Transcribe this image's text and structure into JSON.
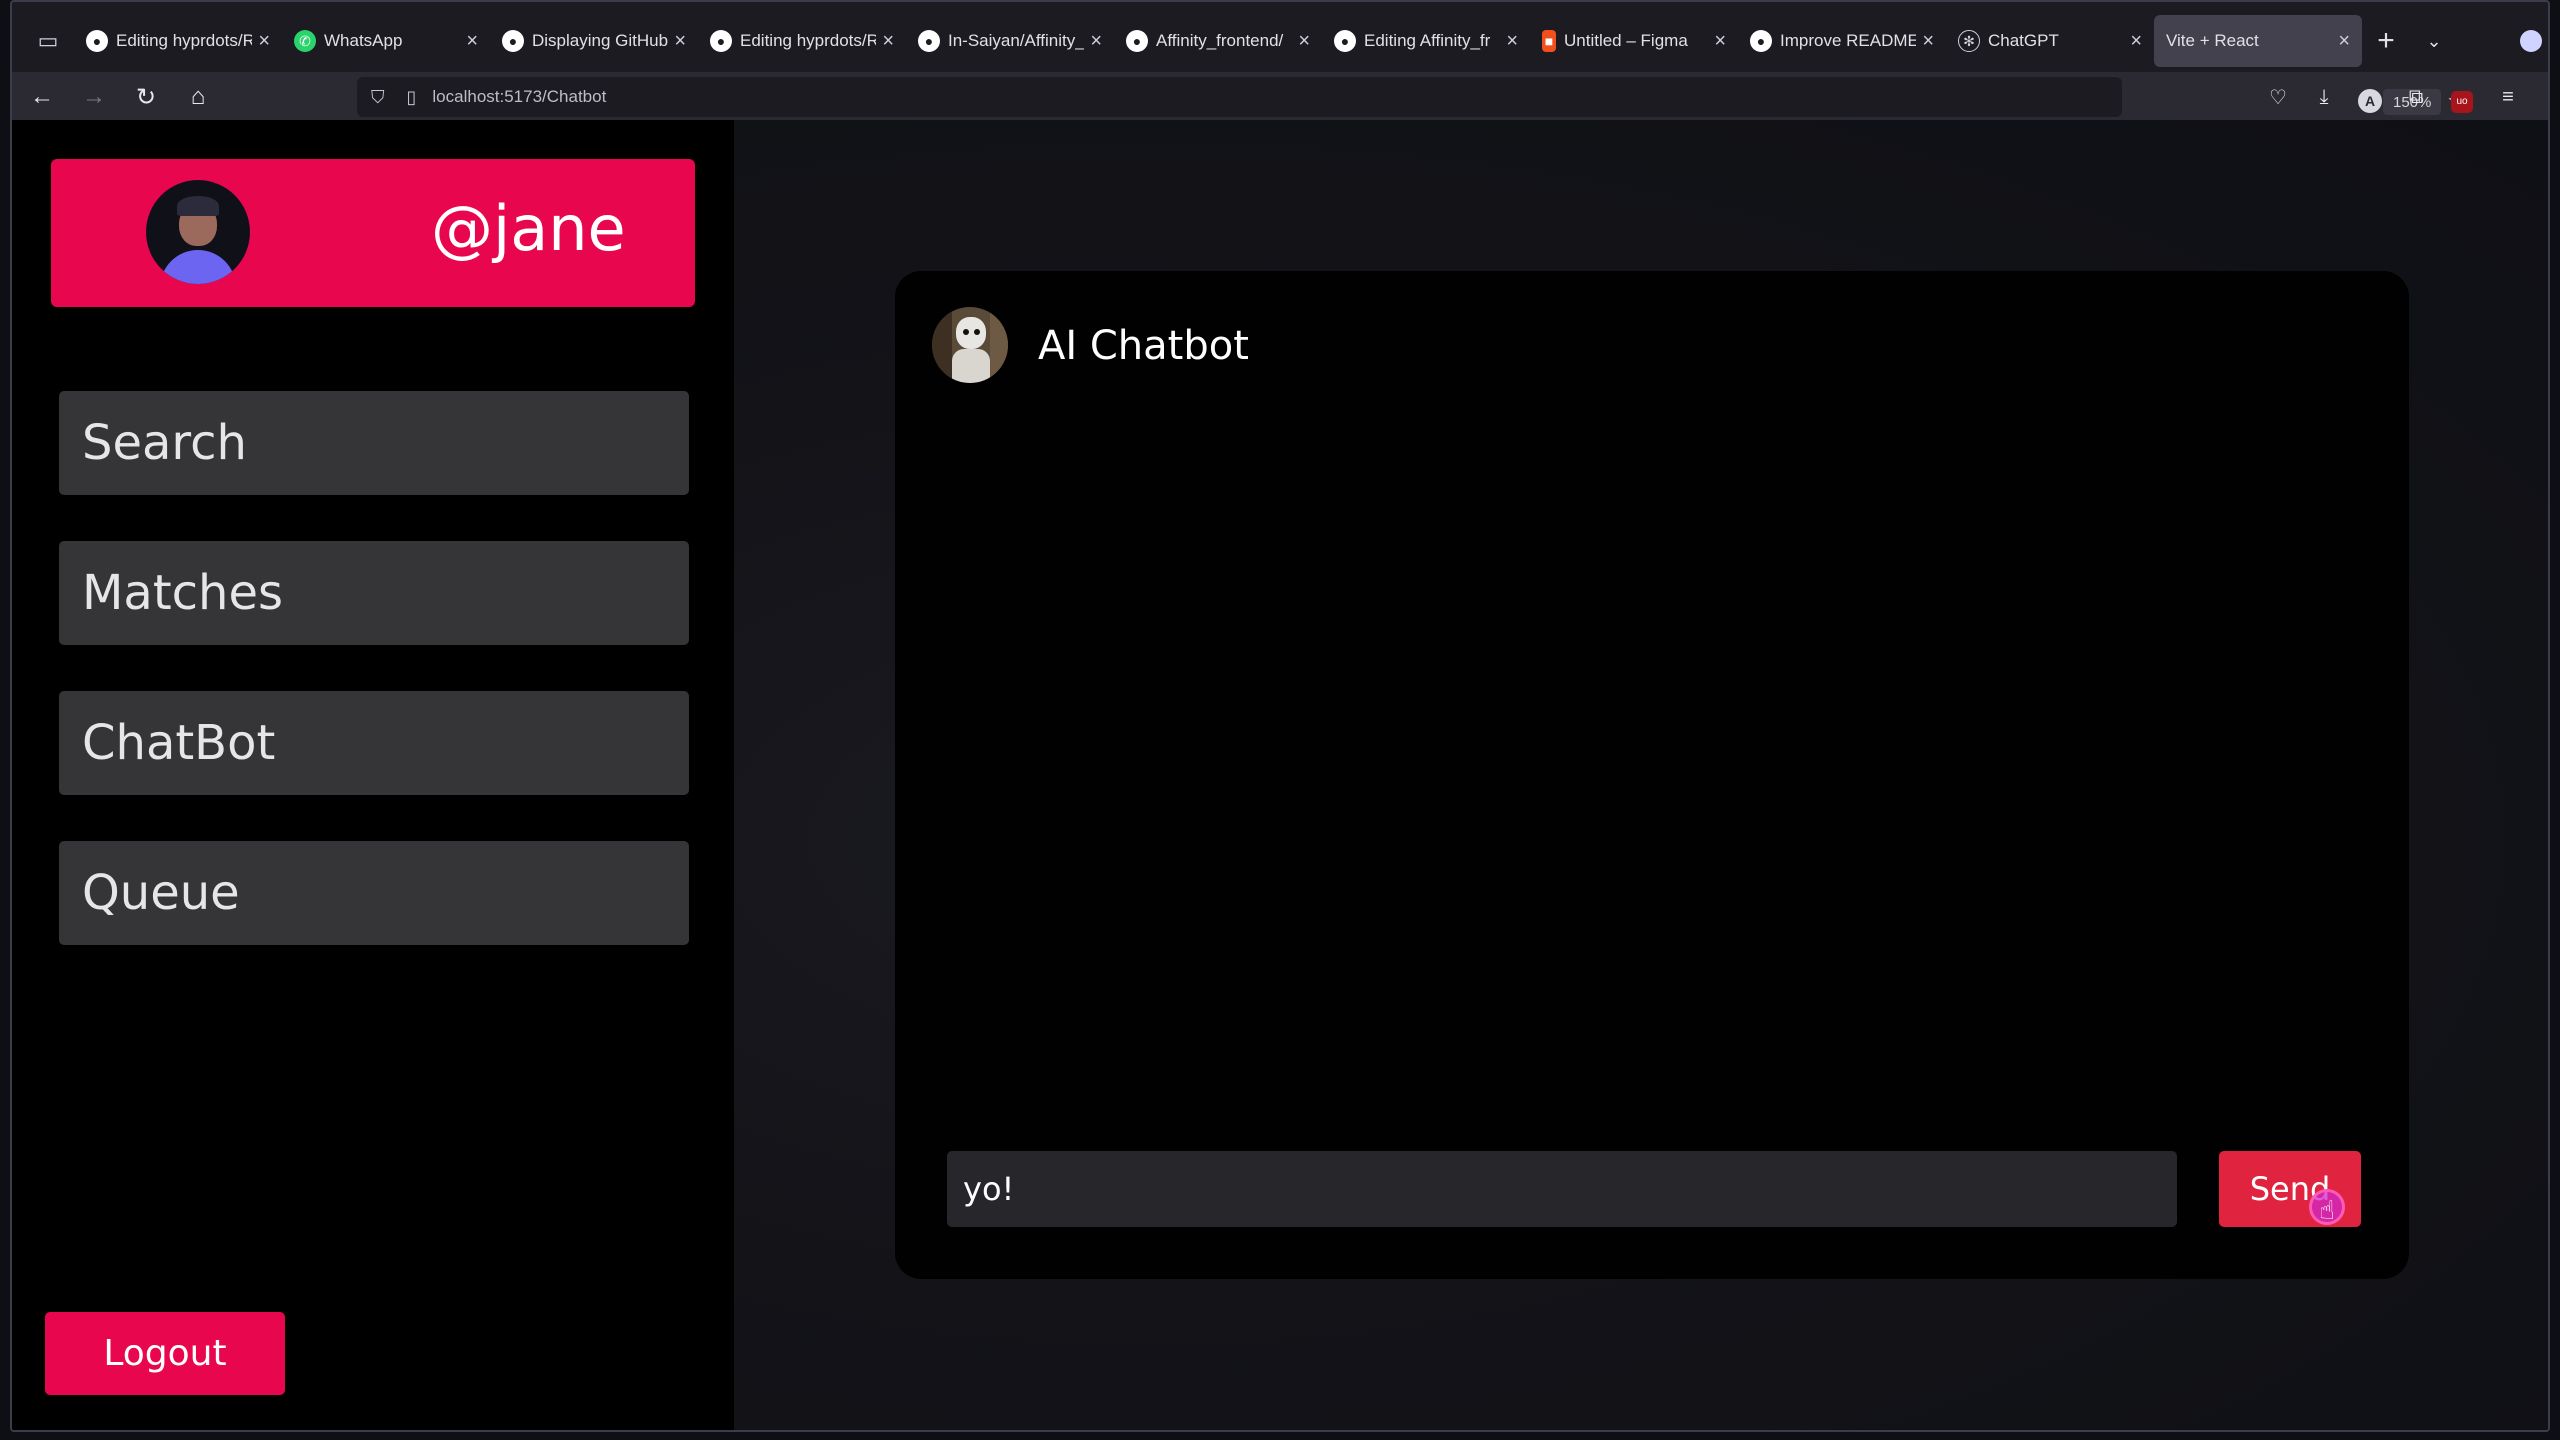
{
  "browser": {
    "tabs": [
      {
        "label": "Editing hyprdots/R",
        "icon": "github-icon"
      },
      {
        "label": "WhatsApp",
        "icon": "whatsapp-icon"
      },
      {
        "label": "Displaying GitHub",
        "icon": "github-icon"
      },
      {
        "label": "Editing hyprdots/R",
        "icon": "github-icon"
      },
      {
        "label": "In-Saiyan/Affinity_",
        "icon": "github-icon"
      },
      {
        "label": "Affinity_frontend/",
        "icon": "github-icon"
      },
      {
        "label": "Editing Affinity_fr",
        "icon": "github-icon"
      },
      {
        "label": "Untitled – Figma",
        "icon": "figma-icon"
      },
      {
        "label": "Improve README.",
        "icon": "github-icon"
      },
      {
        "label": "ChatGPT",
        "icon": "chatgpt-icon"
      },
      {
        "label": "Vite + React",
        "icon": "",
        "active": true
      }
    ],
    "url": "localhost:5173/Chatbot",
    "zoom": "150%"
  },
  "sidebar": {
    "username": "@jane",
    "nav_items": [
      {
        "label": "Search"
      },
      {
        "label": "Matches"
      },
      {
        "label": "ChatBot"
      },
      {
        "label": "Queue"
      }
    ],
    "logout_label": "Logout"
  },
  "chat": {
    "title": "AI Chatbot",
    "input_value": "yo!",
    "send_label": "Send"
  },
  "colors": {
    "accent": "#e8064f",
    "send": "#e0233f",
    "nav_item_bg": "#353538",
    "panel_bg": "#010102"
  }
}
